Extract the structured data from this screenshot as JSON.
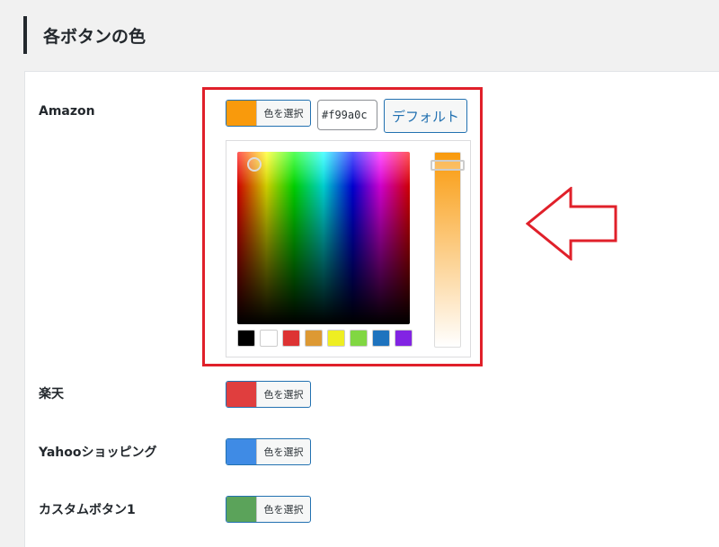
{
  "section": {
    "title": "各ボタンの色"
  },
  "rows": [
    {
      "label": "Amazon",
      "button_label": "色を選択",
      "color": "#f99a0c"
    },
    {
      "label": "楽天",
      "button_label": "色を選択",
      "color": "#e03e3e"
    },
    {
      "label": "Yahooショッピング",
      "button_label": "色を選択",
      "color": "#3f8be5"
    },
    {
      "label": "カスタムボタン1",
      "button_label": "色を選択",
      "color": "#5ba35a"
    }
  ],
  "picker": {
    "hex_value": "#f99a0c",
    "default_label": "デフォルト",
    "palette": [
      "#000000",
      "#ffffff",
      "#dd3333",
      "#dd9933",
      "#eeee22",
      "#81d742",
      "#1e73be",
      "#8224e3"
    ]
  },
  "annotation": {
    "highlight_color": "#e0202a"
  }
}
